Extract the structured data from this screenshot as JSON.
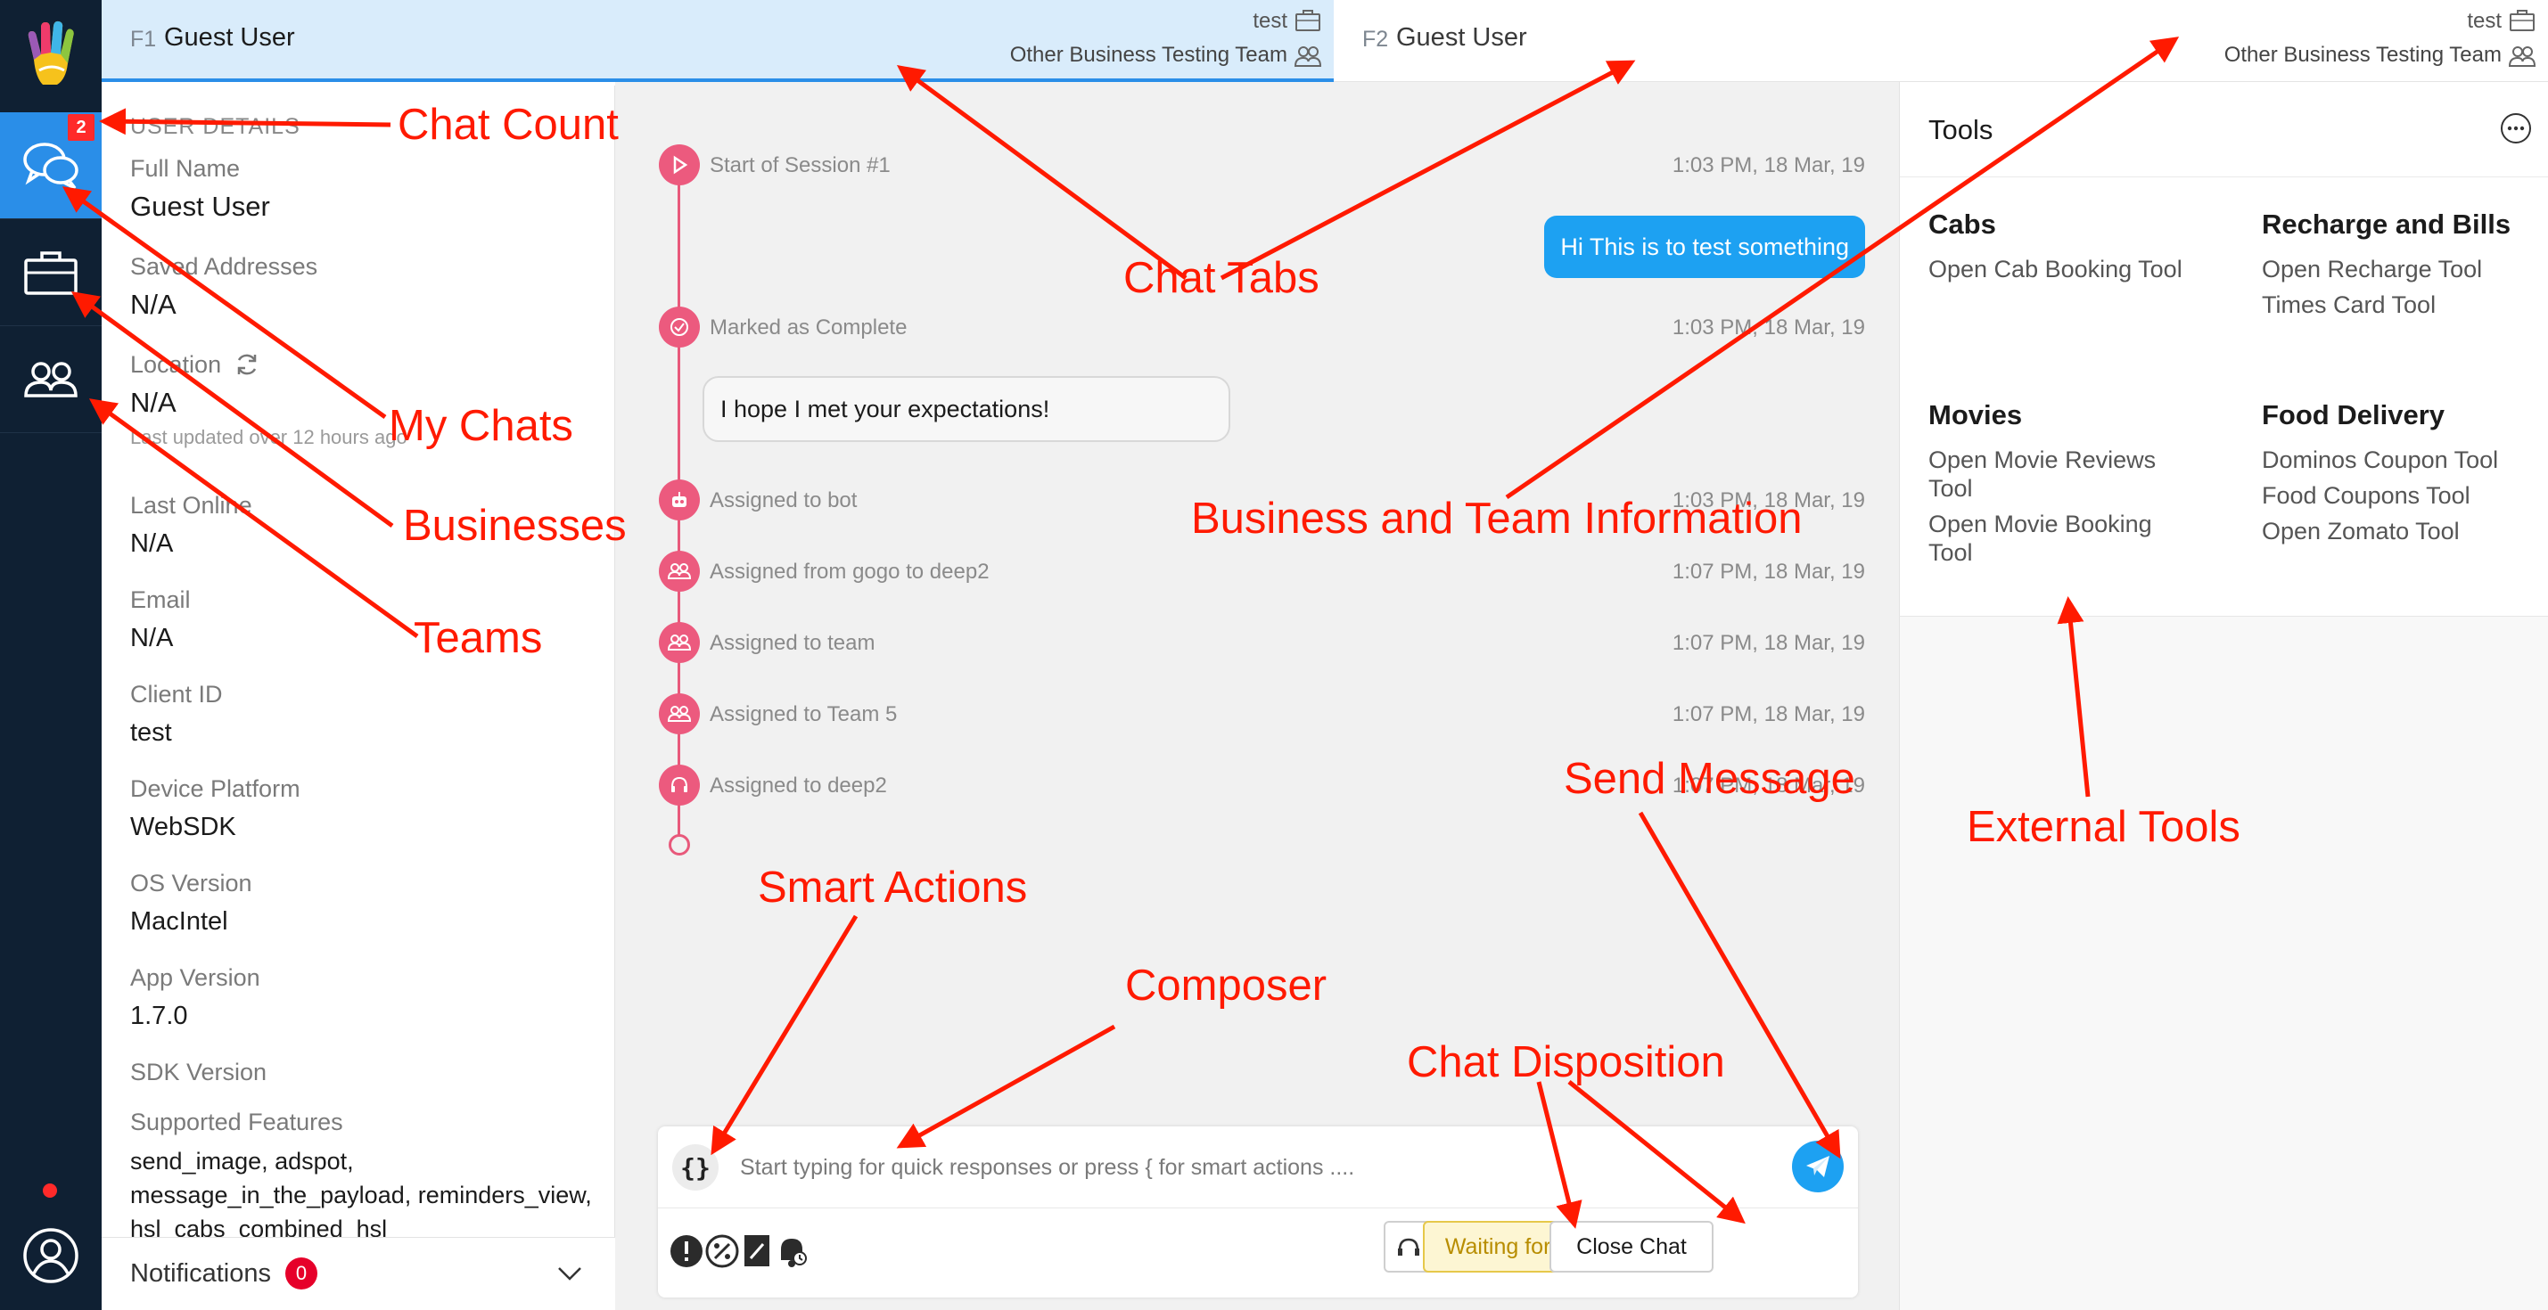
{
  "rail": {
    "chat_count": "2",
    "items": [
      {
        "name": "chats",
        "icon": "chat-bubbles-icon"
      },
      {
        "name": "businesses",
        "icon": "briefcase-icon"
      },
      {
        "name": "teams",
        "icon": "team-icon"
      }
    ],
    "accent": "#2a8ee8"
  },
  "tabs": [
    {
      "key": "F1",
      "name": "Guest User",
      "business": "test",
      "team": "Other Business Testing Team"
    },
    {
      "key": "F2",
      "name": "Guest User",
      "business": "test",
      "team": "Other Business Testing Team"
    }
  ],
  "details": {
    "header": "USER DETAILS",
    "full_name_label": "Full Name",
    "full_name": "Guest User",
    "saved_addresses_label": "Saved Addresses",
    "saved_addresses": "N/A",
    "location_label": "Location",
    "location": "N/A",
    "location_updated": "Last updated over 12 hours ago",
    "last_online_label": "Last Online",
    "last_online": "N/A",
    "email_label": "Email",
    "email": "N/A",
    "client_id_label": "Client ID",
    "client_id": "test",
    "device_platform_label": "Device Platform",
    "device_platform": "WebSDK",
    "os_version_label": "OS Version",
    "os_version": "MacIntel",
    "app_version_label": "App Version",
    "app_version": "1.7.0",
    "sdk_version_label": "SDK Version",
    "supported_features_label": "Supported Features",
    "supported_features": "send_image, adspot, message_in_the_payload, reminders_view, hsl_cabs_combined_hsl"
  },
  "notifications": {
    "label": "Notifications",
    "count": "0"
  },
  "chat": {
    "events": [
      {
        "text": "Start of Session #1",
        "time": "1:03 PM, 18 Mar, 19"
      },
      {
        "text": "Marked as Complete",
        "time": "1:03 PM, 18 Mar, 19"
      },
      {
        "text": "Assigned to bot",
        "time": "1:03 PM, 18 Mar, 19"
      },
      {
        "text": "Assigned from gogo to deep2",
        "time": "1:07 PM, 18 Mar, 19"
      },
      {
        "text": "Assigned to team",
        "time": "1:07 PM, 18 Mar, 19"
      },
      {
        "text": "Assigned to Team 5",
        "time": "1:07 PM, 18 Mar, 19"
      },
      {
        "text": "Assigned to deep2",
        "time": "1:07 PM, 18 Mar, 19"
      }
    ],
    "outgoing_message": "Hi This is to test something",
    "bot_message": "I hope I met your expectations!"
  },
  "composer": {
    "smart_actions_glyph": "{}",
    "placeholder": "Start typing for quick responses or press { for smart actions ....",
    "waiting_label": "Waiting for User",
    "close_label": "Close Chat"
  },
  "tools": {
    "title": "Tools",
    "groups": [
      {
        "title": "Cabs",
        "links": [
          "Open Cab Booking Tool"
        ]
      },
      {
        "title": "Recharge and Bills",
        "links": [
          "Open Recharge Tool",
          "Times Card Tool"
        ]
      },
      {
        "title": "Movies",
        "links": [
          "Open Movie Reviews Tool",
          "Open Movie Booking Tool"
        ]
      },
      {
        "title": "Food Delivery",
        "links": [
          "Dominos Coupon Tool",
          "Food Coupons Tool",
          "Open Zomato Tool"
        ]
      }
    ]
  },
  "annotations": {
    "chat_count": "Chat Count",
    "my_chats": "My Chats",
    "businesses": "Businesses",
    "teams": "Teams",
    "chat_tabs": "Chat Tabs",
    "business_team_info": "Business and Team Information",
    "external_tools": "External Tools",
    "send_message": "Send Message",
    "smart_actions": "Smart Actions",
    "composer": "Composer",
    "chat_disposition": "Chat Disposition",
    "color": "#ff1a00"
  }
}
